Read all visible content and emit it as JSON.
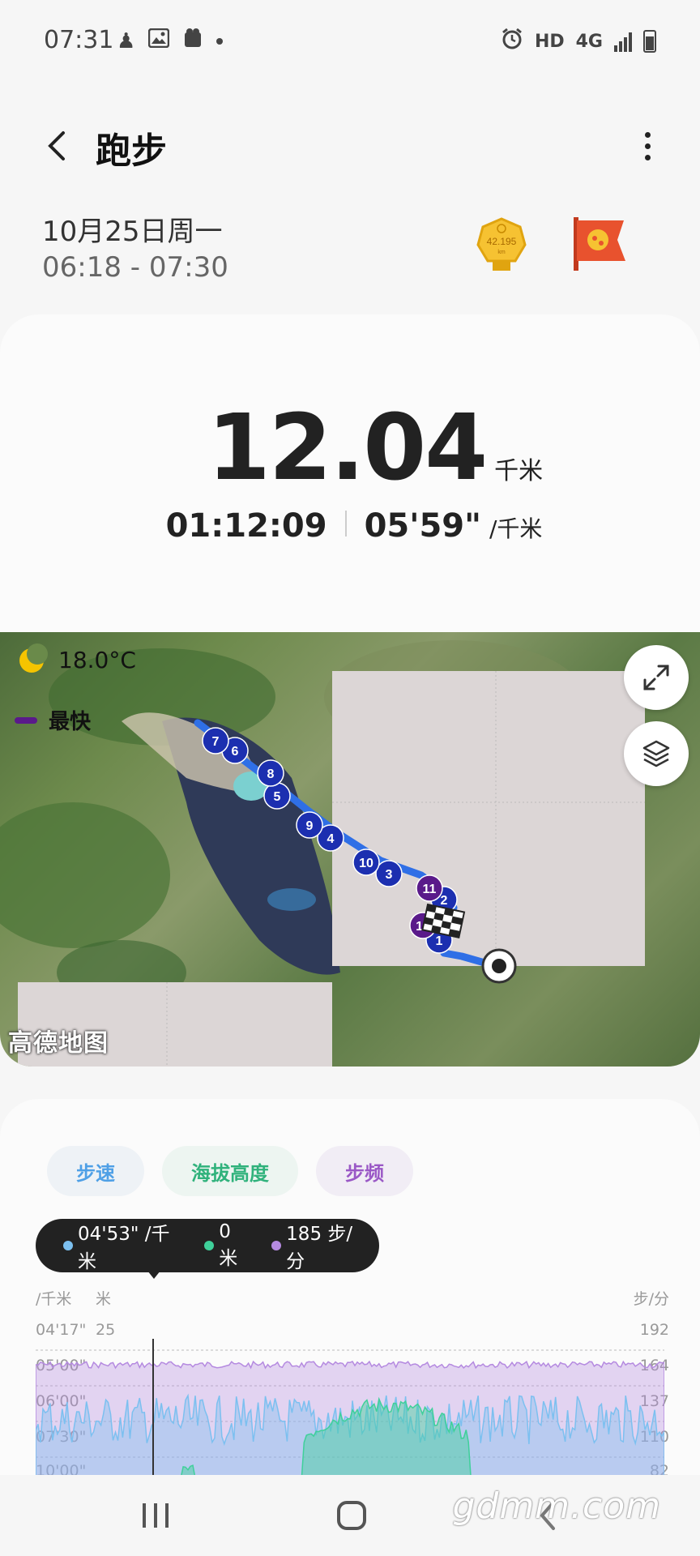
{
  "status_bar": {
    "time": "07:31",
    "left_icons": [
      "figure-icon",
      "gallery-icon",
      "app-icon",
      "dot"
    ],
    "right_icons": [
      "alarm-icon",
      "hd-badge",
      "4g-icon",
      "signal-icon",
      "battery-icon"
    ],
    "hd": "HD",
    "network": "4G"
  },
  "header": {
    "title": "跑步"
  },
  "session": {
    "date": "10月25日周一",
    "time_range": "06:18 - 07:30",
    "medal_text": "42.195",
    "medal_unit": "km"
  },
  "summary": {
    "distance": "12.04",
    "distance_unit": "千米",
    "duration": "01:12:09",
    "pace": "05'59\"",
    "pace_unit": "/千米"
  },
  "map": {
    "temperature": "18.0°C",
    "legend_label": "最快",
    "provider": "高德地图",
    "markers": [
      "1",
      "2",
      "3",
      "4",
      "5",
      "6",
      "7",
      "8",
      "9",
      "10",
      "11",
      "12"
    ],
    "colors": {
      "normal": "#1c2fb0",
      "fastest": "#5a1a8a",
      "route": "#2f6fe6"
    }
  },
  "chart": {
    "tabs": [
      "步速",
      "海拔高度",
      "步频"
    ],
    "tooltip": {
      "pace": "04'53\" /千米",
      "altitude": "0 米",
      "cadence": "185 步/分"
    },
    "left_axis_units": [
      "/千米",
      "米"
    ],
    "right_axis_unit": "步/分",
    "left_ticks": [
      "04'17\"",
      "05'00\"",
      "06'00\"",
      "07'30\"",
      "10'00\""
    ],
    "altitude_tick": "25",
    "right_ticks": [
      "192",
      "164",
      "137",
      "110",
      "82"
    ],
    "colors": {
      "pace": "#7cc0f0",
      "altitude": "#3fd09a",
      "cadence": "#b58ae0"
    }
  },
  "nav": {
    "buttons": [
      "recent-apps",
      "home",
      "back"
    ]
  },
  "watermark": "gdmm.com"
}
